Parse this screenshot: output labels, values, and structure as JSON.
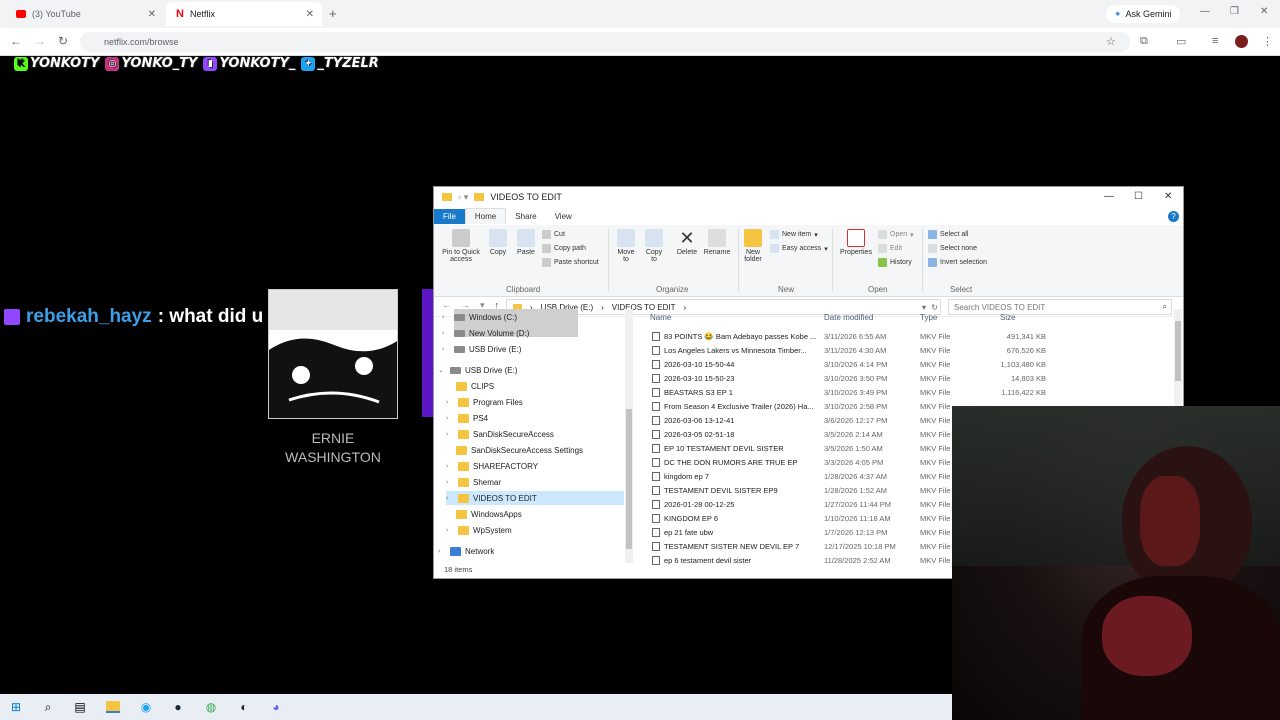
{
  "browser": {
    "tabs": [
      {
        "label": "(3) YouTube",
        "icon": "youtube-icon",
        "color": "#ff0000"
      },
      {
        "label": "Netflix",
        "icon": "netflix-icon",
        "color": "#e50914"
      }
    ],
    "new_tab": "+",
    "ask_gemini": "Ask Gemini",
    "url": "netflix.com/browse"
  },
  "overlay": {
    "socials": [
      {
        "handle": "YONKOTY",
        "icon": "kick-icon",
        "color": "#53fc18"
      },
      {
        "handle": "YONKO_TY",
        "icon": "instagram-icon",
        "color": "#c13584"
      },
      {
        "handle": "YONKOTY_",
        "icon": "twitch-icon",
        "color": "#9146ff"
      },
      {
        "handle": "_TYZELR",
        "icon": "twitter-icon",
        "color": "#1da1f2"
      }
    ],
    "chat": {
      "user": "rebekah_hayz",
      "message": ": what did u say?"
    },
    "card_name": "ERNIE\nWASHINGTON"
  },
  "explorer": {
    "title": "VIDEOS TO EDIT",
    "ribbon_tabs": [
      "File",
      "Home",
      "Share",
      "View"
    ],
    "clipboard": {
      "pin": "Pin to Quick access",
      "copy": "Copy",
      "paste": "Paste",
      "cut": "Cut",
      "copy_path": "Copy path",
      "paste_shortcut": "Paste shortcut",
      "label": "Clipboard"
    },
    "organize": {
      "move": "Move to",
      "copy": "Copy to",
      "delete": "Delete",
      "rename": "Rename",
      "label": "Organize"
    },
    "new": {
      "folder": "New folder",
      "item": "New item",
      "easy": "Easy access",
      "label": "New"
    },
    "open": {
      "properties": "Properties",
      "open": "Open",
      "edit": "Edit",
      "history": "History",
      "label": "Open"
    },
    "select": {
      "all": "Select all",
      "none": "Select none",
      "invert": "Invert selection",
      "label": "Select"
    },
    "path": [
      "USB Drive (E:)",
      "VIDEOS TO EDIT"
    ],
    "search_placeholder": "Search VIDEOS TO EDIT",
    "tree": [
      {
        "label": "Windows (C:)",
        "kind": "drive"
      },
      {
        "label": "New Volume (D:)",
        "kind": "drive"
      },
      {
        "label": "USB Drive (E:)",
        "kind": "drive"
      },
      {
        "label": "USB Drive (E:)",
        "kind": "drive"
      },
      {
        "label": "CLIPS",
        "kind": "folder"
      },
      {
        "label": "Program Files",
        "kind": "folder"
      },
      {
        "label": "PS4",
        "kind": "folder"
      },
      {
        "label": "SanDiskSecureAccess",
        "kind": "folder"
      },
      {
        "label": "SanDiskSecureAccess Settings",
        "kind": "folder"
      },
      {
        "label": "SHAREFACTORY",
        "kind": "folder"
      },
      {
        "label": "Shemar",
        "kind": "folder"
      },
      {
        "label": "VIDEOS TO EDIT",
        "kind": "folder"
      },
      {
        "label": "WindowsApps",
        "kind": "folder"
      },
      {
        "label": "WpSystem",
        "kind": "folder"
      },
      {
        "label": "Network",
        "kind": "network"
      }
    ],
    "columns": [
      "Name",
      "Date modified",
      "Type",
      "Size"
    ],
    "files": [
      {
        "name": "83 POINTS 😂 Bam Adebayo passes Kobe ...",
        "date": "3/11/2026 6:55 AM",
        "type": "MKV File",
        "size": "491,341 KB"
      },
      {
        "name": "Los Angeles Lakers vs Minnesota Timber...",
        "date": "3/11/2026 4:30 AM",
        "type": "MKV File",
        "size": "676,526 KB"
      },
      {
        "name": "2026-03-10 15-50-44",
        "date": "3/10/2026 4:14 PM",
        "type": "MKV File",
        "size": "1,103,480 KB"
      },
      {
        "name": "2026-03-10 15-50-23",
        "date": "3/10/2026 3:50 PM",
        "type": "MKV File",
        "size": "14,803 KB"
      },
      {
        "name": "BEASTARS S3 EP 1",
        "date": "3/10/2026 3:49 PM",
        "type": "MKV File",
        "size": "1,116,422 KB"
      },
      {
        "name": "From Season 4 Exclusive Trailer (2026) Ha...",
        "date": "3/10/2026 2:58 PM",
        "type": "MKV File",
        "size": ""
      },
      {
        "name": "2026-03-06 13-12-41",
        "date": "3/6/2026 12:17 PM",
        "type": "MKV File",
        "size": ""
      },
      {
        "name": "2026-03-05 02-51-18",
        "date": "3/5/2026 2:14 AM",
        "type": "MKV File",
        "size": ""
      },
      {
        "name": "EP 10 TESTAMENT DEVIL SISTER",
        "date": "3/5/2026 1:50 AM",
        "type": "MKV File",
        "size": ""
      },
      {
        "name": "DC THE DON RUMORS ARE TRUE EP",
        "date": "3/3/2026 4:05 PM",
        "type": "MKV File",
        "size": ""
      },
      {
        "name": "kingdom ep 7",
        "date": "1/28/2026 4:37 AM",
        "type": "MKV File",
        "size": ""
      },
      {
        "name": "TESTAMENT DEVIL SISTER EP9",
        "date": "1/28/2026 1:52 AM",
        "type": "MKV File",
        "size": ""
      },
      {
        "name": "2026-01-28 00-12-25",
        "date": "1/27/2026 11:44 PM",
        "type": "MKV File",
        "size": ""
      },
      {
        "name": "KINGDOM EP 6",
        "date": "1/10/2026 11:18 AM",
        "type": "MKV File",
        "size": ""
      },
      {
        "name": "ep 21 fate ubw",
        "date": "1/7/2026 12:13 PM",
        "type": "MKV File",
        "size": ""
      },
      {
        "name": "TESTAMENT SISTER NEW DEVIL EP 7",
        "date": "12/17/2025 10:18 PM",
        "type": "MKV File",
        "size": ""
      },
      {
        "name": "ep 6 testament devil sister",
        "date": "11/28/2025 2:52 AM",
        "type": "MKV File",
        "size": ""
      }
    ],
    "status": "18 items"
  },
  "taskbar": [
    "start-icon",
    "search-icon",
    "task-view-icon",
    "file-explorer-icon",
    "edge-icon",
    "steam-icon",
    "chrome-icon",
    "obs-icon",
    "discord-icon"
  ]
}
